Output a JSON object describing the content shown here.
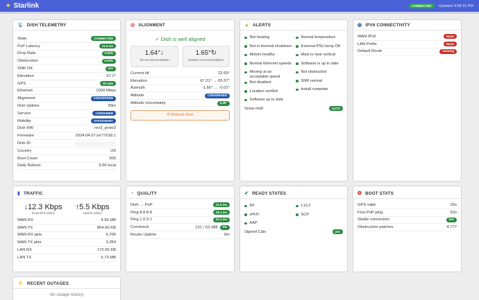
{
  "app": {
    "brand": "Starlink",
    "status": "CONNECTED",
    "updated": "Updated 4:58:16 PM"
  },
  "telemetry": {
    "title": "DISH TELEMETRY",
    "rows": [
      {
        "label": "State",
        "value": "CONNECTED",
        "kind": "badge-green"
      },
      {
        "label": "PoP Latency",
        "value": "21.5 ms",
        "kind": "badge-green"
      },
      {
        "label": "Drop Rate",
        "value": "0.00%",
        "kind": "badge-green"
      },
      {
        "label": "Obstruction",
        "value": "0.00%",
        "kind": "badge-green"
      },
      {
        "label": "SNR OK",
        "value": "yes",
        "kind": "badge-green"
      },
      {
        "label": "Elevation",
        "value": "67.2°",
        "kind": "text"
      },
      {
        "label": "GPS",
        "value": "20 sats",
        "kind": "badge-green"
      },
      {
        "label": "Ethernet",
        "value": "1000 Mbps",
        "kind": "text"
      },
      {
        "label": "Alignment",
        "value": "CONVERGED",
        "kind": "badge-blue"
      },
      {
        "label": "Dish Uptime",
        "value": "59m",
        "kind": "text"
      },
      {
        "label": "Service",
        "value": "CONSUMER",
        "kind": "badge-blue"
      },
      {
        "label": "Mobility",
        "value": "STATIONARY",
        "kind": "badge-blue"
      },
      {
        "label": "Dish HW",
        "value": "rev3_proto2",
        "kind": "text"
      },
      {
        "label": "Firmware",
        "value": "2024.04.07.mr77639.1",
        "kind": "text"
      },
      {
        "label": "Dish ID",
        "value": "",
        "kind": "blur"
      },
      {
        "label": "Country",
        "value": "US",
        "kind": "text"
      },
      {
        "label": "Boot Count",
        "value": "505",
        "kind": "text"
      },
      {
        "label": "Daily Reboot",
        "value": "3:00 local",
        "kind": "text"
      }
    ]
  },
  "alignment": {
    "title": "ALIGNMENT",
    "status": "✓ Dish is well aligned",
    "tilt": {
      "value": "1.64°↓",
      "label": "Tilt recommendation"
    },
    "rotate": {
      "value": "1.65°↻",
      "label": "Rotate recommendation"
    },
    "rows": [
      {
        "label": "Current tilt",
        "value": "22.65°",
        "kind": "text"
      },
      {
        "label": "Elevation",
        "value": "67.21° → 65.57°",
        "kind": "text"
      },
      {
        "label": "Azimuth",
        "value": "-1.66° → -0.01°",
        "kind": "text"
      },
      {
        "label": "Attitude",
        "value": "CONVERGED",
        "kind": "badge-blue"
      },
      {
        "label": "Attitude Uncertainty",
        "value": "0.49°",
        "kind": "badge-green"
      }
    ],
    "reboot": "⟳ Reboot Dish"
  },
  "alerts": {
    "title": "ALERTS",
    "left": [
      "Not heating",
      "Not in thermal shutdown",
      "Motors healthy",
      "Normal Ethernet speeds",
      "Moving at an acceptable speed",
      "Not disabled",
      "Location verified",
      "Software up to date"
    ],
    "right": [
      "Normal temperature",
      "External PSU temp OK",
      "Mast is near vertical",
      "Software is up to date",
      "Not obstructed",
      "SNR normal",
      "Install complete"
    ],
    "snow_label": "Snow melt",
    "snow_value": "AUTO"
  },
  "ipv6": {
    "title": "IPV6 CONNECTIVITY",
    "rows": [
      {
        "label": "WAN IPv6",
        "value": "None",
        "kind": "badge-red"
      },
      {
        "label": "LAN Prefix",
        "value": "None",
        "kind": "badge-red"
      },
      {
        "label": "Default Route",
        "value": "missing",
        "kind": "badge-red"
      }
    ]
  },
  "traffic": {
    "title": "TRAFFIC",
    "down": {
      "value": "12.3 Kbps",
      "label": "Downlink (dish)"
    },
    "up": {
      "value": "5.5 Kbps",
      "label": "Uplink (dish)"
    },
    "rows": [
      {
        "label": "WAN RX",
        "value": "4.96 MB",
        "kind": "text"
      },
      {
        "label": "WAN TX",
        "value": "864.60 KB",
        "kind": "text"
      },
      {
        "label": "WAN RX pkts",
        "value": "6,706",
        "kind": "text"
      },
      {
        "label": "WAN TX pkts",
        "value": "3,354",
        "kind": "text"
      },
      {
        "label": "LAN RX",
        "value": "170.55 KB",
        "kind": "text"
      },
      {
        "label": "LAN TX",
        "value": "5.73 MB",
        "kind": "text"
      }
    ]
  },
  "quality": {
    "title": "QUALITY",
    "rows": [
      {
        "label": "Dish → PoP",
        "value": "21.5 ms",
        "kind": "badge-green"
      },
      {
        "label": "Ping 8.8.8.8",
        "value": "26.1 ms",
        "kind": "badge-green"
      },
      {
        "label": "Ping 1.0.0.1",
        "value": "22.1 ms",
        "kind": "badge-green"
      },
      {
        "label": "Conntrack",
        "value": "231 / 63,488",
        "kind": "conntrack",
        "badge": "0%"
      },
      {
        "label": "Router Uptime",
        "value": "6m",
        "kind": "text"
      }
    ]
  },
  "ready": {
    "title": "READY STATES",
    "left": [
      "RF",
      "xPHY",
      "AAP"
    ],
    "right": [
      "L1/L2",
      "SCP"
    ],
    "signed_label": "Signed Cals",
    "signed_value": "yes"
  },
  "boot": {
    "title": "BOOT STATS",
    "rows": [
      {
        "label": "GPS valid",
        "value": "25s",
        "kind": "text"
      },
      {
        "label": "First PoP ping",
        "value": "52s",
        "kind": "text"
      },
      {
        "label": "Stable connection",
        "value": "53s",
        "kind": "badge-green"
      },
      {
        "label": "Obstruction patches",
        "value": "4,777",
        "kind": "text"
      }
    ]
  },
  "outages": {
    "title": "RECENT OUTAGES",
    "empty": "No outage history"
  },
  "icons": {
    "telemetry": "satellite-dish-icon",
    "alignment": "target-icon",
    "alerts": "bell-icon",
    "ipv6": "globe-icon",
    "traffic": "chart-icon",
    "quality": "gauge-icon",
    "ready": "check-icon",
    "boot": "rocket-icon",
    "outages": "bolt-icon"
  },
  "colors": {
    "brand": "#4a60d6",
    "ok": "#2a8a40",
    "info": "#2457a8",
    "bad": "#c8332d",
    "warn": "#d9742c"
  }
}
